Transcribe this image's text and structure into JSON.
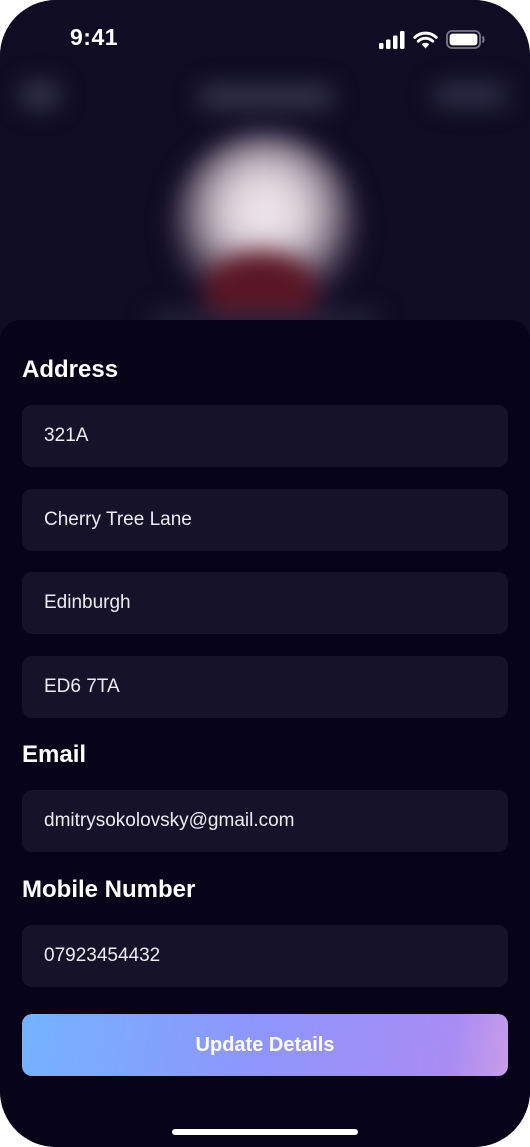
{
  "status_bar": {
    "time": "9:41",
    "icons": [
      "cellular-signal-icon",
      "wifi-icon",
      "battery-icon"
    ]
  },
  "address": {
    "label": "Address",
    "line1": "321A",
    "line2": "Cherry Tree Lane",
    "city": "Edinburgh",
    "postcode": "ED6 7TA"
  },
  "email": {
    "label": "Email",
    "value": "dmitrysokolovsky@gmail.com"
  },
  "mobile": {
    "label": "Mobile Number",
    "value": "07923454432"
  },
  "actions": {
    "update_label": "Update Details"
  },
  "colors": {
    "background": "#07041a",
    "field_background": "#15122a",
    "button_gradient_start": "#74b3ff",
    "button_gradient_end": "#c99de9"
  }
}
